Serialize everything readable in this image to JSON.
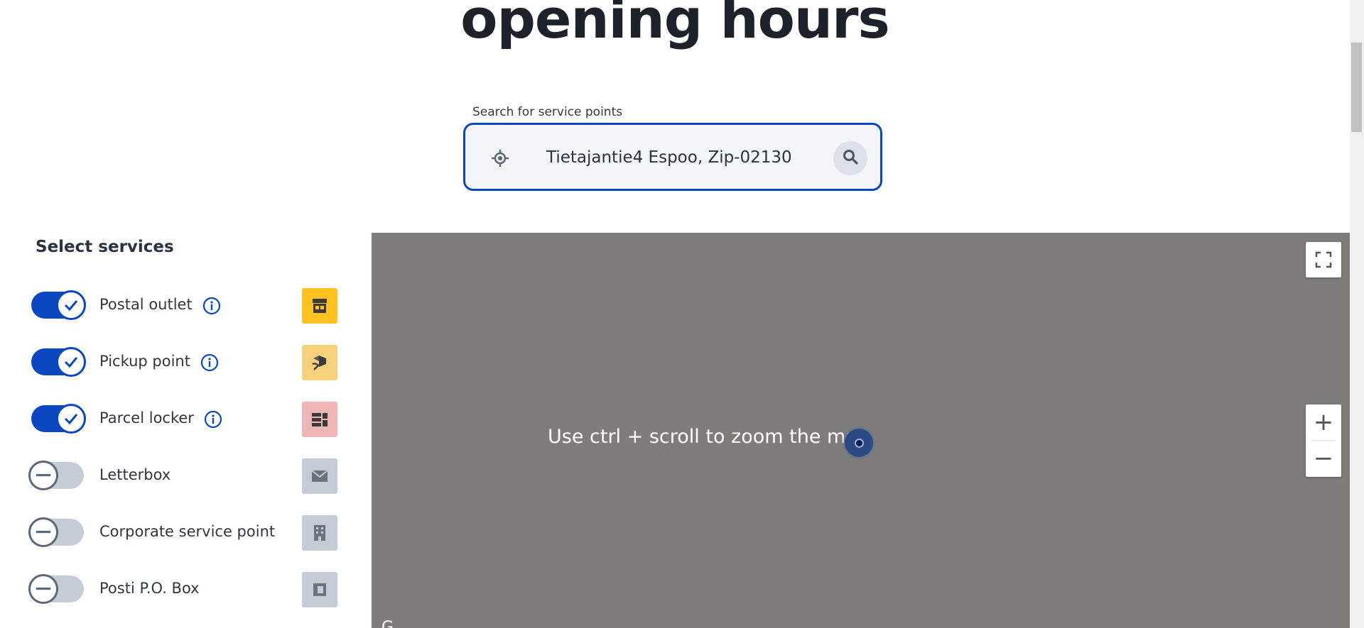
{
  "heading": {
    "title": "opening hours"
  },
  "search": {
    "label": "Search for service points",
    "value": "Tietajantie4 Espoo, Zip-02130",
    "placeholder": ""
  },
  "services": {
    "title": "Select services",
    "items": [
      {
        "label": "Postal outlet",
        "enabled": true,
        "has_info": true,
        "icon": "shop-icon",
        "color": "#ffc21f"
      },
      {
        "label": "Pickup point",
        "enabled": true,
        "has_info": true,
        "icon": "parcel-handover-icon",
        "color": "#f7d07b"
      },
      {
        "label": "Parcel locker",
        "enabled": true,
        "has_info": true,
        "icon": "locker-icon",
        "color": "#efb6b8"
      },
      {
        "label": "Letterbox",
        "enabled": false,
        "has_info": false,
        "icon": "envelope-icon",
        "color": "#c5ccd6"
      },
      {
        "label": "Corporate service point",
        "enabled": false,
        "has_info": false,
        "icon": "building-icon",
        "color": "#c5ccd6"
      },
      {
        "label": "Posti P.O. Box",
        "enabled": false,
        "has_info": false,
        "icon": "po-box-icon",
        "color": "#c5ccd6"
      }
    ]
  },
  "map": {
    "hint": "Use ctrl + scroll to zoom the map",
    "zoom_in": "+",
    "zoom_out": "−",
    "attribution": "G",
    "background": "#7f7d79"
  },
  "colors": {
    "accent": "#0b47c0",
    "toggle_off": "#c5ccd6"
  }
}
